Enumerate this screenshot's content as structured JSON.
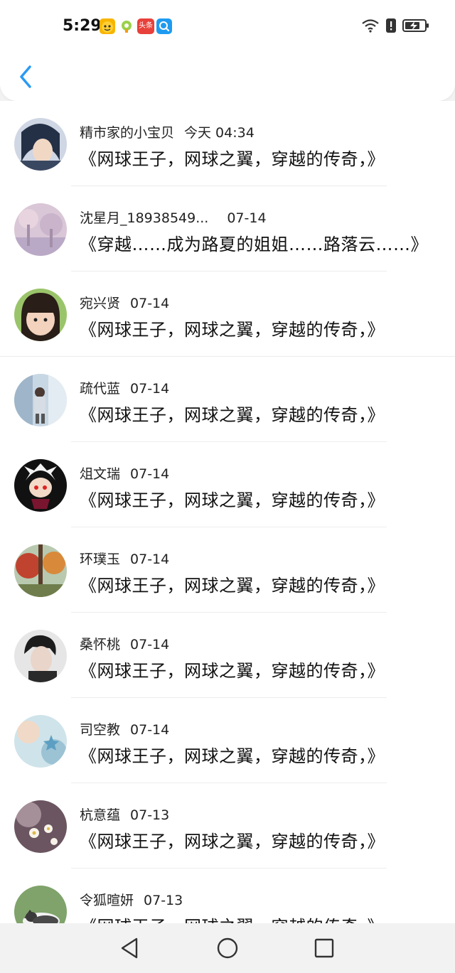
{
  "status_bar": {
    "time": "5:29",
    "notification_icons": [
      "app-icon-1",
      "app-icon-2",
      "toutiao-icon",
      "search-app-icon"
    ],
    "toutiao_label": "头条",
    "right_icons": [
      "wifi-icon",
      "alert-icon",
      "battery-charging-icon"
    ]
  },
  "header": {
    "back_icon": "chevron-left-icon"
  },
  "conversations": [
    {
      "name": "精市家的小宝贝",
      "date": "今天 04:34",
      "message": "《网球王子，网球之翼，穿越的传奇，》"
    },
    {
      "name": "沈星月_18938549...",
      "date": "07-14",
      "message": "《穿越……成为路夏的姐姐……路落云……》"
    },
    {
      "name": "宛兴贤",
      "date": "07-14",
      "message": "《网球王子，网球之翼，穿越的传奇，》"
    },
    {
      "name": "疏代蓝",
      "date": "07-14",
      "message": "《网球王子，网球之翼，穿越的传奇，》"
    },
    {
      "name": "俎文瑞",
      "date": "07-14",
      "message": "《网球王子，网球之翼，穿越的传奇，》"
    },
    {
      "name": "环璞玉",
      "date": "07-14",
      "message": "《网球王子，网球之翼，穿越的传奇，》"
    },
    {
      "name": "桑怀桃",
      "date": "07-14",
      "message": "《网球王子，网球之翼，穿越的传奇，》"
    },
    {
      "name": "司空教",
      "date": "07-14",
      "message": "《网球王子，网球之翼，穿越的传奇，》"
    },
    {
      "name": "杭意蕴",
      "date": "07-13",
      "message": "《网球王子，网球之翼，穿越的传奇，》"
    },
    {
      "name": "令狐暄妍",
      "date": "07-13",
      "message": "《网球王子，网球之翼，穿越的传奇，》"
    }
  ],
  "nav_bar": {
    "icons": [
      "back-triangle-icon",
      "home-circle-icon",
      "recents-square-icon"
    ]
  },
  "colors": {
    "accent": "#2b9af3",
    "background": "#ffffff",
    "nav_background": "#f2f2f2"
  }
}
